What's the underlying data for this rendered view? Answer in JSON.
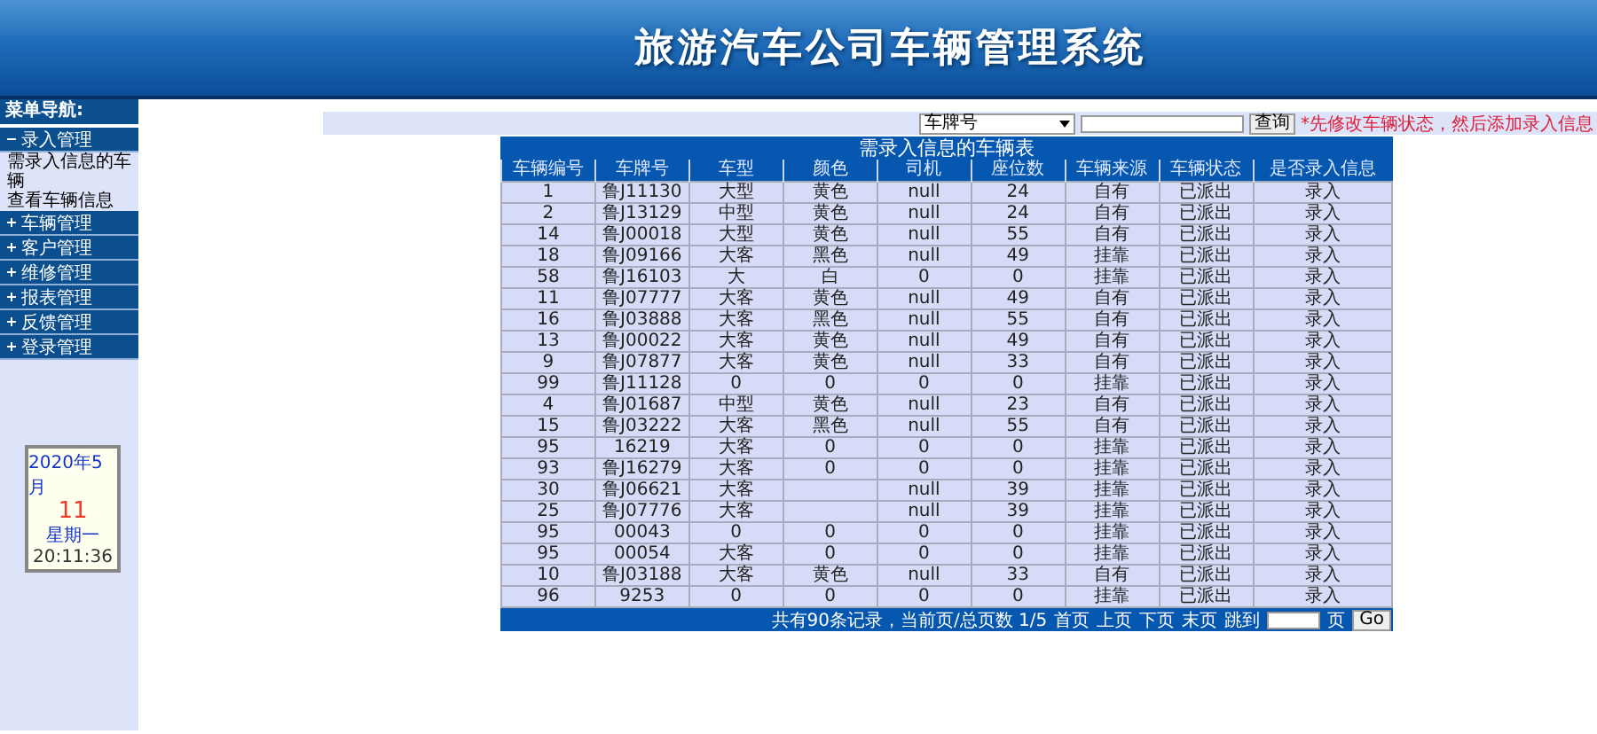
{
  "header": {
    "title": "旅游汽车公司车辆管理系统"
  },
  "sidebar": {
    "title": "菜单导航:",
    "items": [
      {
        "label": "录入管理",
        "expanded": true,
        "children": [
          {
            "label": "需录入信息的车辆"
          },
          {
            "label": "查看车辆信息"
          }
        ]
      },
      {
        "label": "车辆管理",
        "expanded": false
      },
      {
        "label": "客户管理",
        "expanded": false
      },
      {
        "label": "维修管理",
        "expanded": false
      },
      {
        "label": "报表管理",
        "expanded": false
      },
      {
        "label": "反馈管理",
        "expanded": false
      },
      {
        "label": "登录管理",
        "expanded": false
      }
    ]
  },
  "calendar": {
    "month": "2020年5月",
    "day": "11",
    "weekday": "星期一",
    "time": "20:11:36"
  },
  "search": {
    "field": "车牌号",
    "button": "查询",
    "note": "*先修改车辆状态，然后添加录入信息"
  },
  "table": {
    "title": "需录入信息的车辆表",
    "columns": [
      "车辆编号",
      "车牌号",
      "车型",
      "颜色",
      "司机",
      "座位数",
      "车辆来源",
      "车辆状态",
      "是否录入信息"
    ],
    "rows": [
      [
        "1",
        "鲁J11130",
        "大型",
        "黄色",
        "null",
        "24",
        "自有",
        "已派出",
        "录入"
      ],
      [
        "2",
        "鲁J13129",
        "中型",
        "黄色",
        "null",
        "24",
        "自有",
        "已派出",
        "录入"
      ],
      [
        "14",
        "鲁J00018",
        "大型",
        "黄色",
        "null",
        "55",
        "自有",
        "已派出",
        "录入"
      ],
      [
        "18",
        "鲁J09166",
        "大客",
        "黑色",
        "null",
        "49",
        "挂靠",
        "已派出",
        "录入"
      ],
      [
        "58",
        "鲁J16103",
        "大",
        "白",
        "0",
        "0",
        "挂靠",
        "已派出",
        "录入"
      ],
      [
        "11",
        "鲁J07777",
        "大客",
        "黄色",
        "null",
        "49",
        "自有",
        "已派出",
        "录入"
      ],
      [
        "16",
        "鲁J03888",
        "大客",
        "黑色",
        "null",
        "55",
        "自有",
        "已派出",
        "录入"
      ],
      [
        "13",
        "鲁J00022",
        "大客",
        "黄色",
        "null",
        "49",
        "自有",
        "已派出",
        "录入"
      ],
      [
        "9",
        "鲁J07877",
        "大客",
        "黄色",
        "null",
        "33",
        "自有",
        "已派出",
        "录入"
      ],
      [
        "99",
        "鲁J11128",
        "0",
        "0",
        "0",
        "0",
        "挂靠",
        "已派出",
        "录入"
      ],
      [
        "4",
        "鲁J01687",
        "中型",
        "黄色",
        "null",
        "23",
        "自有",
        "已派出",
        "录入"
      ],
      [
        "15",
        "鲁J03222",
        "大客",
        "黑色",
        "null",
        "55",
        "自有",
        "已派出",
        "录入"
      ],
      [
        "95",
        "16219",
        "大客",
        "0",
        "0",
        "0",
        "挂靠",
        "已派出",
        "录入"
      ],
      [
        "93",
        "鲁J16279",
        "大客",
        "0",
        "0",
        "0",
        "挂靠",
        "已派出",
        "录入"
      ],
      [
        "30",
        "鲁J06621",
        "大客",
        null,
        "null",
        "39",
        "挂靠",
        "已派出",
        "录入"
      ],
      [
        "25",
        "鲁J07776",
        "大客",
        null,
        "null",
        "39",
        "挂靠",
        "已派出",
        "录入"
      ],
      [
        "95",
        "00043",
        "0",
        "0",
        "0",
        "0",
        "挂靠",
        "已派出",
        "录入"
      ],
      [
        "95",
        "00054",
        "大客",
        "0",
        "0",
        "0",
        "挂靠",
        "已派出",
        "录入"
      ],
      [
        "10",
        "鲁J03188",
        "大客",
        "黄色",
        "null",
        "33",
        "自有",
        "已派出",
        "录入"
      ],
      [
        "96",
        "9253",
        "0",
        "0",
        "0",
        "0",
        "挂靠",
        "已派出",
        "录入"
      ]
    ]
  },
  "pager": {
    "summary": "共有90条记录，当前页/总页数 1/5",
    "links": [
      "首页",
      "上页",
      "下页",
      "末页"
    ],
    "jump_label": "跳到",
    "page_unit": "页",
    "go": "Go"
  }
}
